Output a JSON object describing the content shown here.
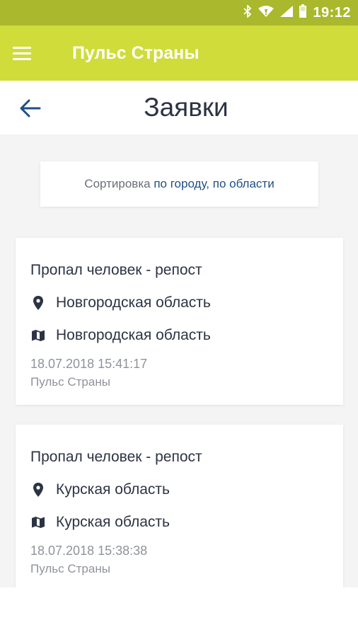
{
  "status_bar": {
    "time": "19:12",
    "icons": [
      "bluetooth-icon",
      "wifi-icon",
      "signal-icon",
      "battery-icon"
    ]
  },
  "app_bar": {
    "title": "Пульс Страны",
    "menu_icon": "hamburger-menu-icon",
    "color": "#cfdc3a"
  },
  "header": {
    "title": "Заявки",
    "back_icon": "arrow-left-icon"
  },
  "sort": {
    "label": "Сортировка",
    "by_city": "по городу,",
    "by_region": "по области"
  },
  "requests": [
    {
      "title": "Пропал человек - репост",
      "location": "Новгородская область",
      "region": "Новгородская область",
      "datetime": "18.07.2018 15:41:17",
      "source": "Пульс Страны"
    },
    {
      "title": "Пропал человек - репост",
      "location": "Курская область",
      "region": "Курская область",
      "datetime": "18.07.2018 15:38:38",
      "source": "Пульс Страны"
    }
  ],
  "colors": {
    "accent": "#cfdc3a",
    "status_bar": "#a9b82c",
    "link": "#1f4f86",
    "back_arrow": "#1f4f86",
    "text": "#2c3343"
  }
}
